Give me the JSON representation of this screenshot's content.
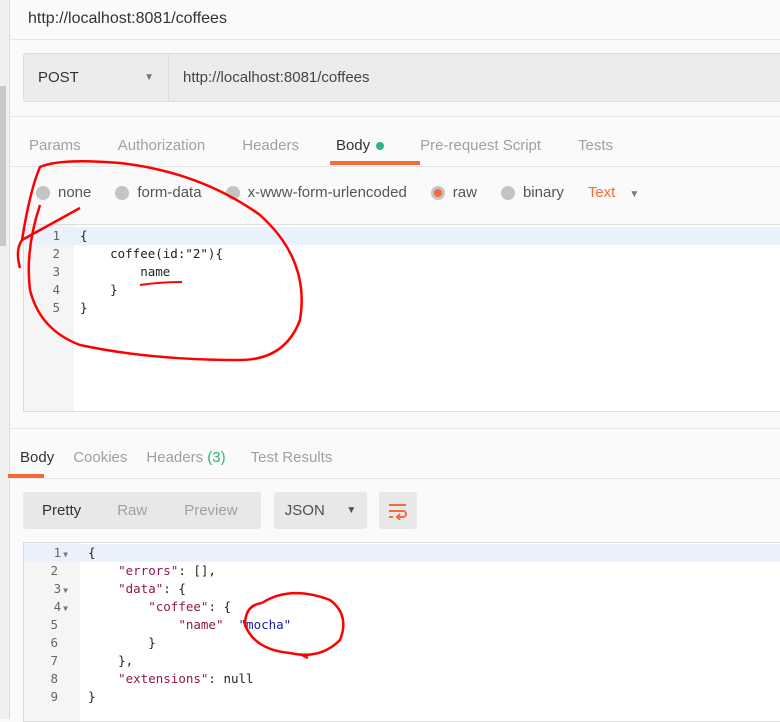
{
  "title": "http://localhost:8081/coffees",
  "request": {
    "method": "POST",
    "url": "http://localhost:8081/coffees"
  },
  "req_tabs": [
    "Params",
    "Authorization",
    "Headers",
    "Body",
    "Pre-request Script",
    "Tests"
  ],
  "body_modes": [
    "none",
    "form-data",
    "x-www-form-urlencoded",
    "raw",
    "binary"
  ],
  "body_type": "Text",
  "request_body": [
    "{",
    "    coffee(id:\"2\"){",
    "        name",
    "    }",
    "}"
  ],
  "res_tabs": {
    "body": "Body",
    "cookies": "Cookies",
    "headers": "Headers",
    "headers_count": "(3)",
    "tests": "Test Results"
  },
  "view": {
    "pretty": "Pretty",
    "raw": "Raw",
    "preview": "Preview",
    "format": "JSON"
  },
  "response": {
    "l1": "{",
    "k_errors": "\"errors\"",
    "v_errors": ": [],",
    "k_data": "\"data\"",
    "v_data": ": {",
    "k_coffee": "\"coffee\"",
    "v_coffee": ": {",
    "k_name": "\"name\"",
    "v_name": "\"mocha\"",
    "l6": "}",
    "l7": "},",
    "k_ext": "\"extensions\"",
    "v_ext": ": null",
    "l9": "}"
  },
  "colors": {
    "accent": "#f26b3a",
    "dot": "#2cb67d",
    "annotation": "#ff0000"
  }
}
